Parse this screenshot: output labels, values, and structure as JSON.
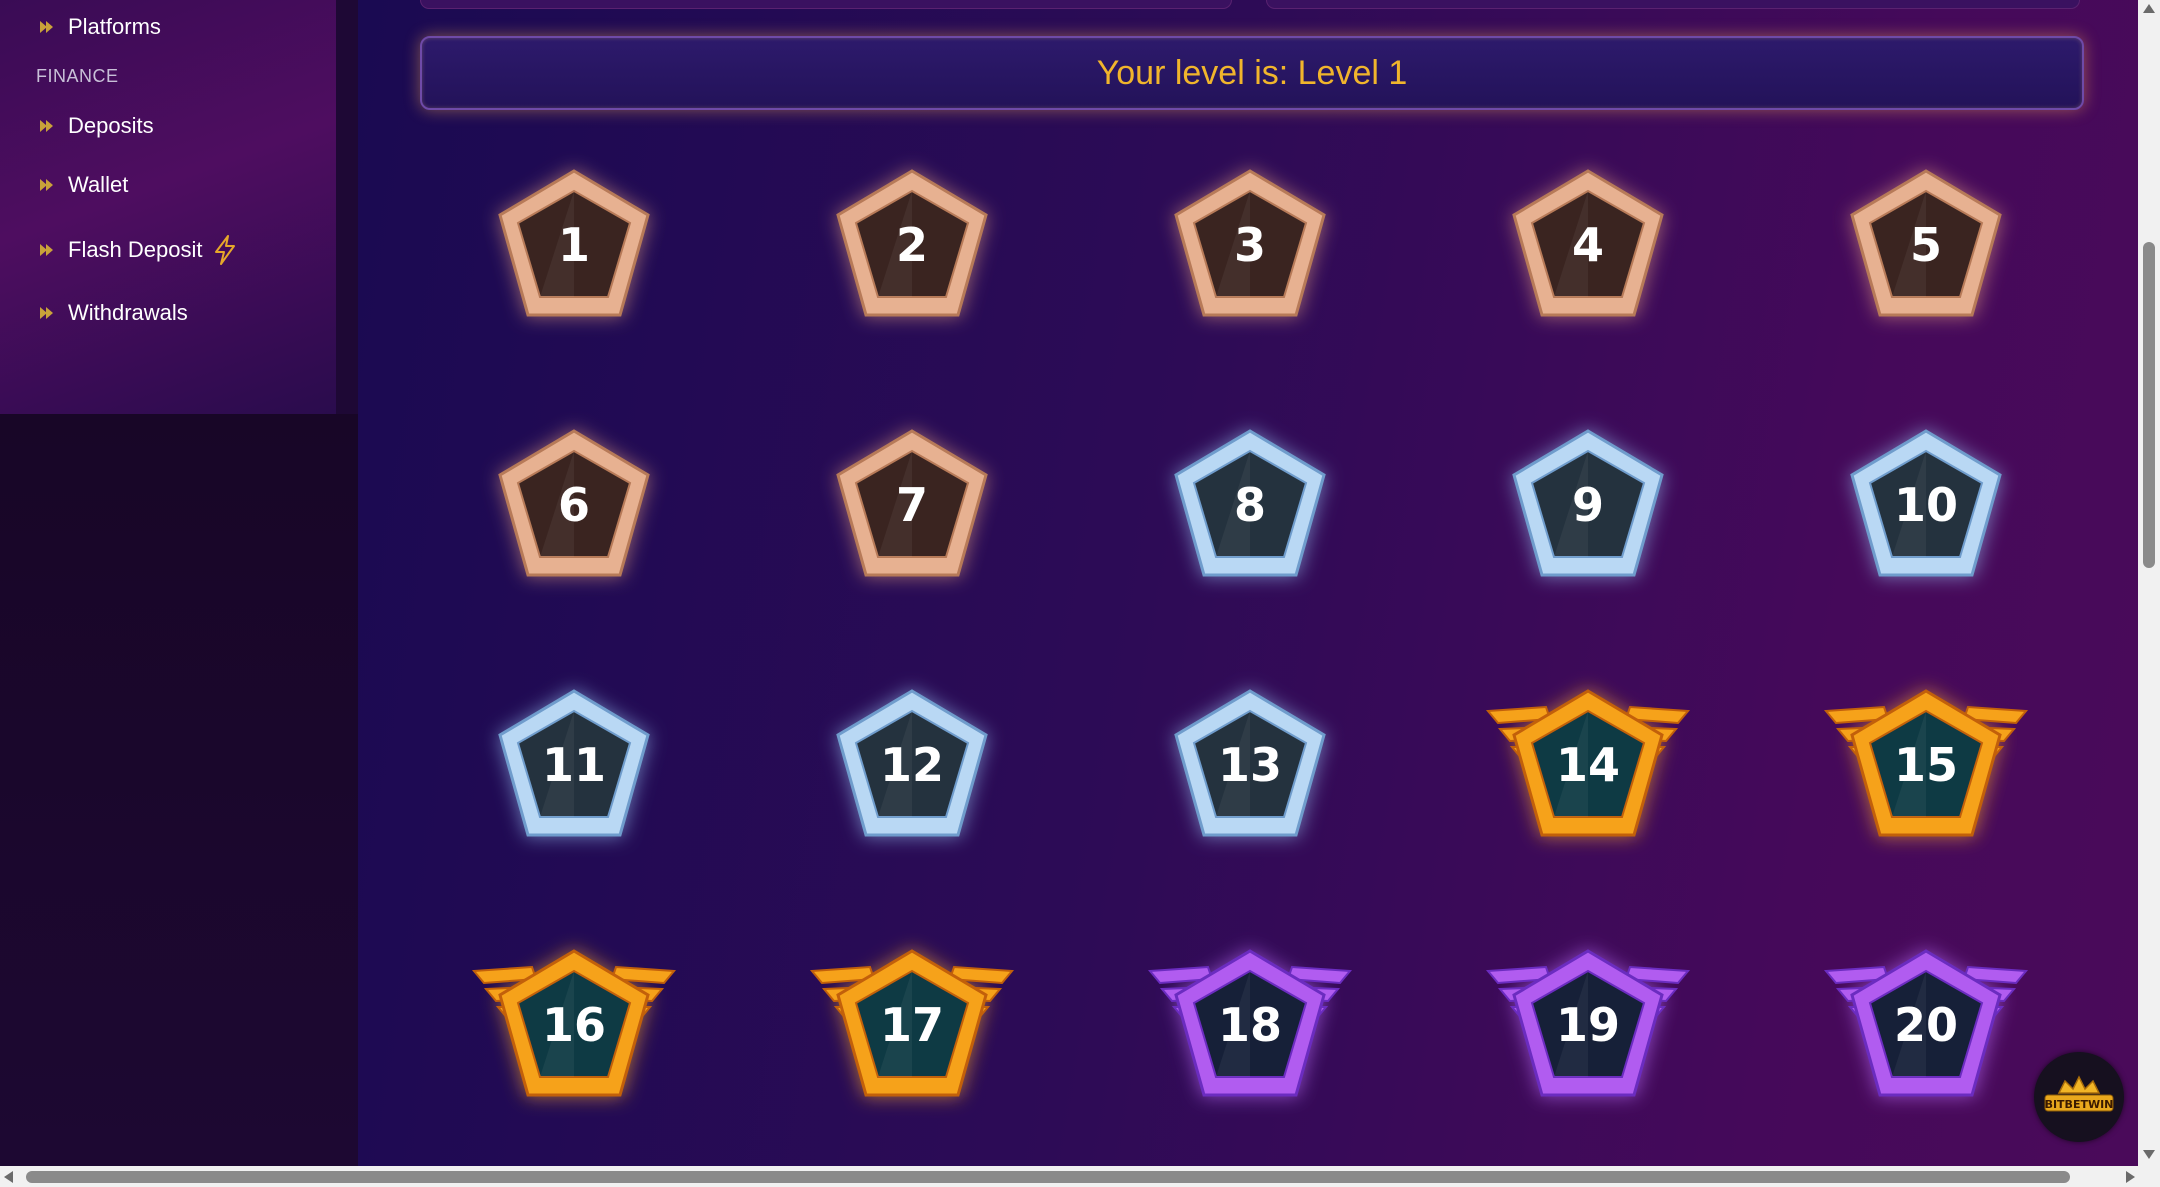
{
  "sidebar": {
    "items_top": [
      {
        "label": "Platforms",
        "icon": "double-chevron-icon"
      }
    ],
    "section_label": "FINANCE",
    "items": [
      {
        "label": "Deposits",
        "icon": "double-chevron-icon"
      },
      {
        "label": "Wallet",
        "icon": "double-chevron-icon"
      },
      {
        "label": "Flash Deposit",
        "icon": "double-chevron-icon",
        "extra_icon": "lightning-bolt-icon"
      },
      {
        "label": "Withdrawals",
        "icon": "double-chevron-icon"
      }
    ]
  },
  "level": {
    "text": "Your level is: Level 1"
  },
  "badges": [
    {
      "number": "1",
      "tier": "bronze"
    },
    {
      "number": "2",
      "tier": "bronze"
    },
    {
      "number": "3",
      "tier": "bronze"
    },
    {
      "number": "4",
      "tier": "bronze"
    },
    {
      "number": "5",
      "tier": "bronze"
    },
    {
      "number": "6",
      "tier": "bronze"
    },
    {
      "number": "7",
      "tier": "bronze"
    },
    {
      "number": "8",
      "tier": "silver"
    },
    {
      "number": "9",
      "tier": "silver"
    },
    {
      "number": "10",
      "tier": "silver"
    },
    {
      "number": "11",
      "tier": "silver"
    },
    {
      "number": "12",
      "tier": "silver"
    },
    {
      "number": "13",
      "tier": "silver"
    },
    {
      "number": "14",
      "tier": "gold"
    },
    {
      "number": "15",
      "tier": "gold"
    },
    {
      "number": "16",
      "tier": "gold"
    },
    {
      "number": "17",
      "tier": "gold"
    },
    {
      "number": "18",
      "tier": "purple"
    },
    {
      "number": "19",
      "tier": "purple"
    },
    {
      "number": "20",
      "tier": "purple"
    }
  ],
  "logo": {
    "text": "BITBETWIN",
    "icon": "crown-icon"
  },
  "colors": {
    "accent_gold": "#f1b52c",
    "bronze": "#e7b191",
    "silver": "#b9d8f4",
    "gold": "#f6a21a",
    "purple": "#b15cf0"
  }
}
